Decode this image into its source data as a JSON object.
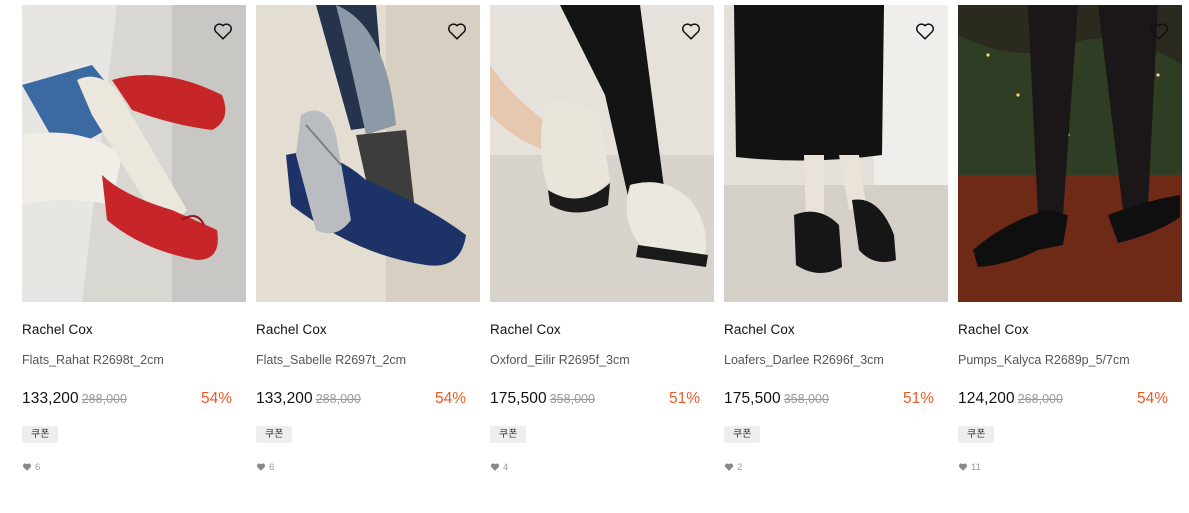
{
  "products": [
    {
      "brand": "Rachel Cox",
      "name": "Flats_Rahat R2698t_2cm",
      "price": "133,200",
      "original_price": "288,000",
      "discount": "54%",
      "badge": "쿠폰",
      "likes": "6",
      "image": "red-ballet-flats-photo"
    },
    {
      "brand": "Rachel Cox",
      "name": "Flats_Sabelle R2697t_2cm",
      "price": "133,200",
      "original_price": "288,000",
      "discount": "54%",
      "badge": "쿠폰",
      "likes": "6",
      "image": "navy-silver-mary-jane-flats-photo"
    },
    {
      "brand": "Rachel Cox",
      "name": "Oxford_Eilir R2695f_3cm",
      "price": "175,500",
      "original_price": "358,000",
      "discount": "51%",
      "badge": "쿠폰",
      "likes": "4",
      "image": "cream-oxford-photo"
    },
    {
      "brand": "Rachel Cox",
      "name": "Loafers_Darlee R2696f_3cm",
      "price": "175,500",
      "original_price": "358,000",
      "discount": "51%",
      "badge": "쿠폰",
      "likes": "2",
      "image": "black-loafers-photo"
    },
    {
      "brand": "Rachel Cox",
      "name": "Pumps_Kalyca R2689p_5/7cm",
      "price": "124,200",
      "original_price": "268,000",
      "discount": "54%",
      "badge": "쿠폰",
      "likes": "11",
      "image": "black-pumps-photo"
    }
  ],
  "icons": {
    "wishlist": "heart-outline-icon",
    "likes": "heart-filled-icon"
  },
  "colors": {
    "discount": "#ea5b24",
    "coupon_bg": "#eeeeee",
    "muted": "#999999"
  }
}
